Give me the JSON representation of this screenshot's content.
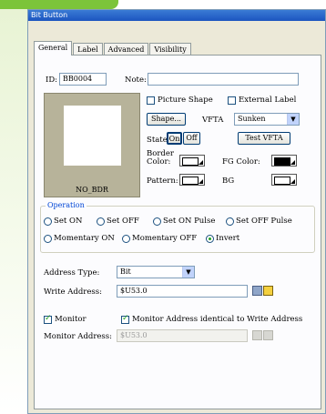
{
  "window": {
    "title": "Bit Button"
  },
  "tabs": [
    "General",
    "Label",
    "Advanced",
    "Visibility"
  ],
  "general": {
    "id_label": "ID:",
    "id_value": "BB0004",
    "note_label": "Note:",
    "note_value": "",
    "preview_caption": "NO_BDR",
    "picture_shape_label": "Picture Shape",
    "external_label_label": "External Label",
    "shape_button": "Shape...",
    "vfta_label": "VFTA",
    "vfta_value": "Sunken",
    "state_label": "State:",
    "state_on": "On",
    "state_off": "Off",
    "test_vfta_button": "Test VFTA",
    "border_color_label": "Border Color:",
    "fg_color_label": "FG Color:",
    "pattern_label": "Pattern:",
    "bg_label": "BG",
    "colors": {
      "border": "#ffffff",
      "fg": "#000000",
      "pattern": "#ffffff",
      "bg": "#ffffff"
    }
  },
  "operation": {
    "title": "Operation",
    "options": [
      "Set ON",
      "Set OFF",
      "Set ON Pulse",
      "Set OFF Pulse",
      "Momentary ON",
      "Momentary OFF",
      "Invert"
    ],
    "selected": "Invert"
  },
  "address": {
    "type_label": "Address Type:",
    "type_value": "Bit",
    "write_label": "Write Address:",
    "write_value": "$U53.0"
  },
  "monitor": {
    "monitor_label": "Monitor",
    "identical_label": "Monitor Address identical to Write Address",
    "address_label": "Monitor Address:",
    "address_value": "$U53.0"
  }
}
